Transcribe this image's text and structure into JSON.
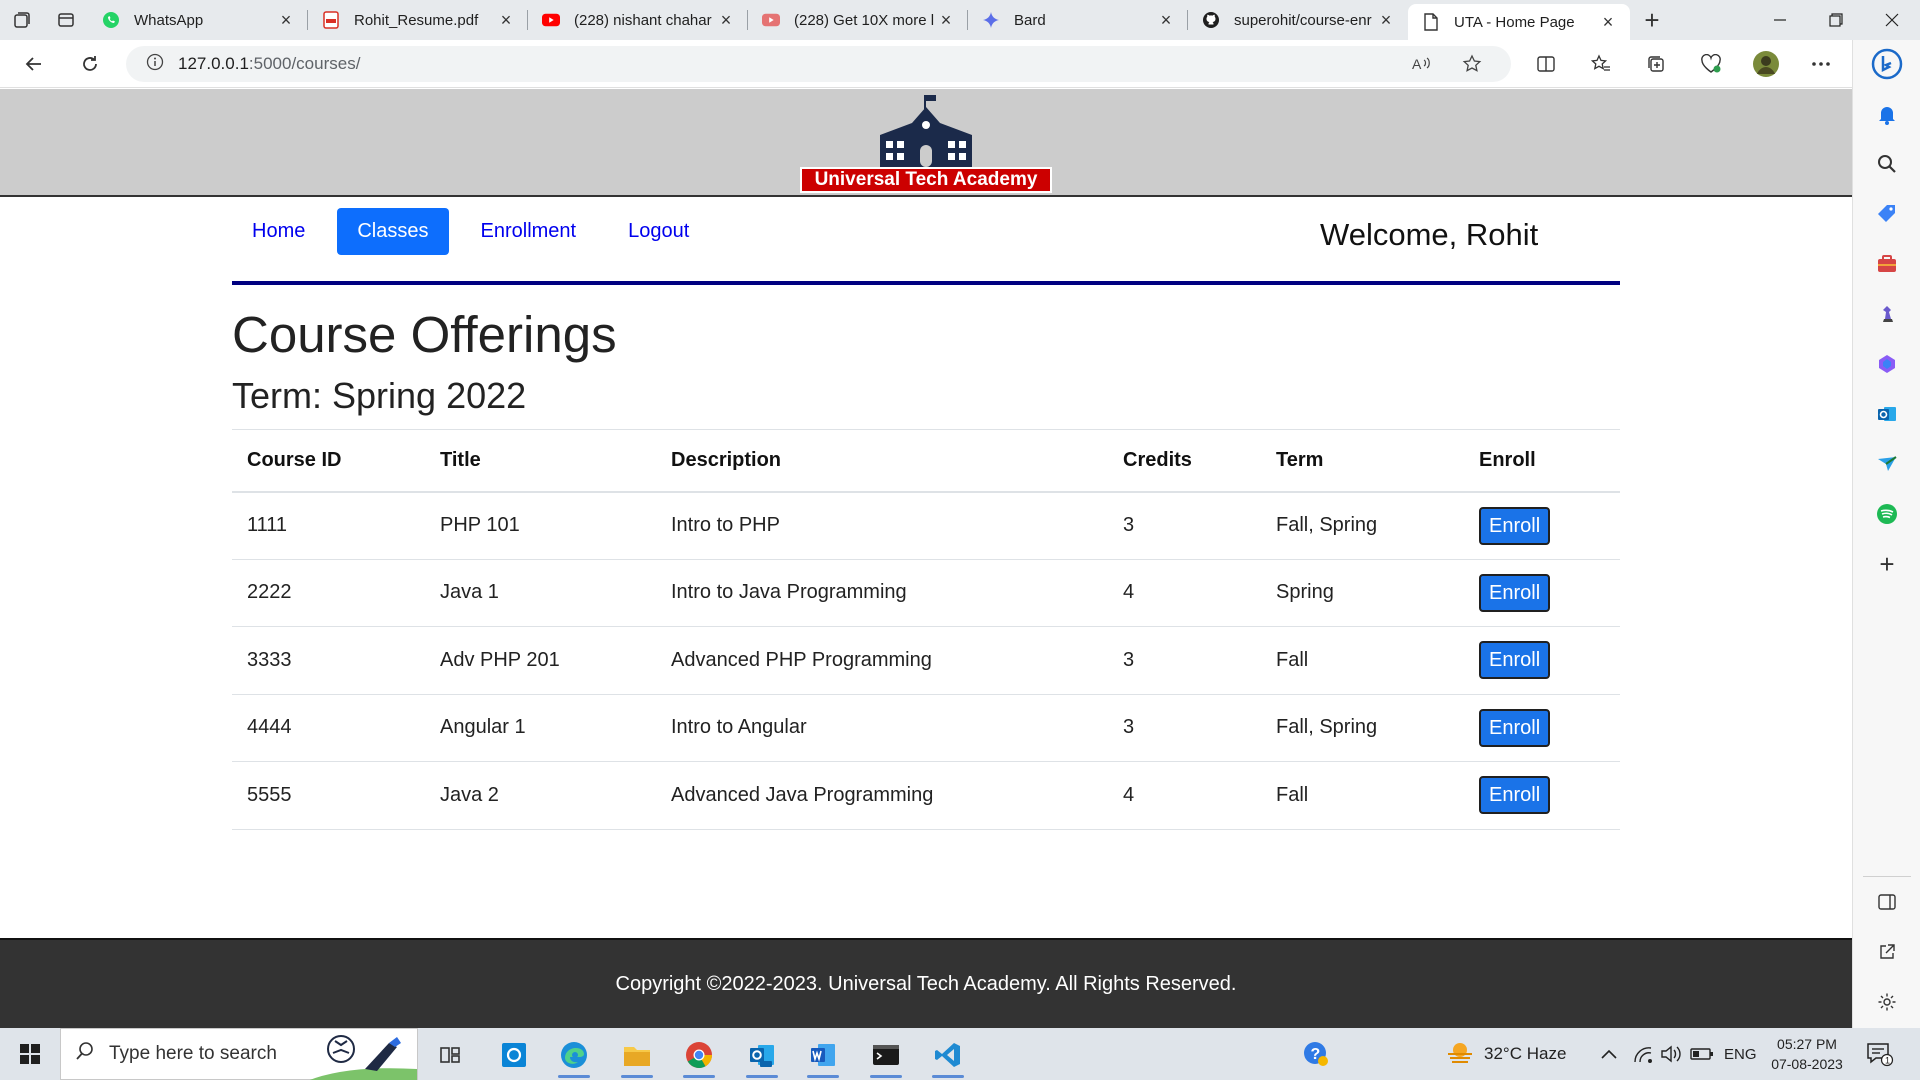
{
  "browser": {
    "tabs": [
      {
        "title": "WhatsApp",
        "icon": "whatsapp-icon"
      },
      {
        "title": "Rohit_Resume.pdf",
        "icon": "pdf-icon"
      },
      {
        "title": "(228) nishant chahar",
        "icon": "youtube-icon"
      },
      {
        "title": "(228) Get 10X more l",
        "icon": "youtube-icon"
      },
      {
        "title": "Bard",
        "icon": "bard-icon"
      },
      {
        "title": "superohit/course-enr",
        "icon": "github-icon"
      },
      {
        "title": "UTA - Home Page",
        "icon": "page-icon"
      }
    ],
    "url_host": "127.0.0.1",
    "url_path": ":5000/courses/"
  },
  "site": {
    "logo_text": "Universal Tech Academy",
    "nav": [
      {
        "label": "Home"
      },
      {
        "label": "Classes"
      },
      {
        "label": "Enrollment"
      },
      {
        "label": "Logout"
      }
    ],
    "active_nav": "Classes",
    "welcome": "Welcome, Rohit",
    "heading": "Course Offerings",
    "term": "Term: Spring 2022",
    "table": {
      "headers": [
        "Course ID",
        "Title",
        "Description",
        "Credits",
        "Term",
        "Enroll"
      ],
      "rows": [
        {
          "id": "1111",
          "title": "PHP 101",
          "description": "Intro to PHP",
          "credits": "3",
          "term": "Fall, Spring",
          "action": "Enroll"
        },
        {
          "id": "2222",
          "title": "Java 1",
          "description": "Intro to Java Programming",
          "credits": "4",
          "term": "Spring",
          "action": "Enroll"
        },
        {
          "id": "3333",
          "title": "Adv PHP 201",
          "description": "Advanced PHP Programming",
          "credits": "3",
          "term": "Fall",
          "action": "Enroll"
        },
        {
          "id": "4444",
          "title": "Angular 1",
          "description": "Intro to Angular",
          "credits": "3",
          "term": "Fall, Spring",
          "action": "Enroll"
        },
        {
          "id": "5555",
          "title": "Java 2",
          "description": "Advanced Java Programming",
          "credits": "4",
          "term": "Fall",
          "action": "Enroll"
        }
      ]
    },
    "footer": "Copyright ©2022-2023. Universal Tech Academy. All Rights Reserved."
  },
  "taskbar": {
    "search_placeholder": "Type here to search",
    "weather": "32°C  Haze",
    "lang": "ENG",
    "time": "05:27 PM",
    "date": "07-08-2023"
  },
  "colors": {
    "nav_active": "#0d6efd",
    "nav_rule": "#000080",
    "enroll_button": "#1a73e8",
    "logo_banner": "#cc0000",
    "footer": "#333333"
  }
}
